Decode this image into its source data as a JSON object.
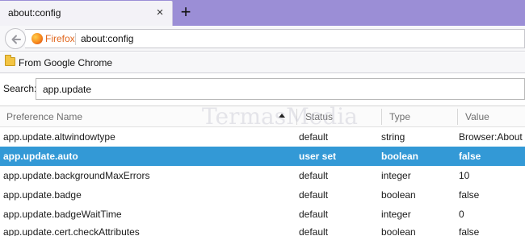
{
  "tab": {
    "title": "about:config",
    "close_glyph": "×",
    "newtab_glyph": "+"
  },
  "navbar": {
    "identity_label": "Firefox",
    "url": "about:config"
  },
  "bookmarks": {
    "items": [
      {
        "label": "From Google Chrome"
      }
    ]
  },
  "search": {
    "label": "Search:",
    "value": "app.update"
  },
  "table": {
    "columns": [
      "Preference Name",
      "Status",
      "Type",
      "Value"
    ],
    "sorted_column": "Preference Name",
    "selected_row": 1,
    "rows": [
      {
        "name": "app.update.altwindowtype",
        "status": "default",
        "type": "string",
        "value": "Browser:About"
      },
      {
        "name": "app.update.auto",
        "status": "user set",
        "type": "boolean",
        "value": "false"
      },
      {
        "name": "app.update.backgroundMaxErrors",
        "status": "default",
        "type": "integer",
        "value": "10"
      },
      {
        "name": "app.update.badge",
        "status": "default",
        "type": "boolean",
        "value": "false"
      },
      {
        "name": "app.update.badgeWaitTime",
        "status": "default",
        "type": "integer",
        "value": "0"
      },
      {
        "name": "app.update.cert.checkAttributes",
        "status": "default",
        "type": "boolean",
        "value": "false"
      }
    ]
  },
  "watermark": {
    "text": "TermasMedia"
  },
  "colors": {
    "tabstrip": "#9b8ed6",
    "selection": "#3399d6",
    "firefox_orange": "#e0661d"
  },
  "icons": {
    "back": "back-arrow-icon",
    "identity": "firefox-logo-icon",
    "bookmark": "folder-icon",
    "sort": "sort-ascending-icon"
  }
}
